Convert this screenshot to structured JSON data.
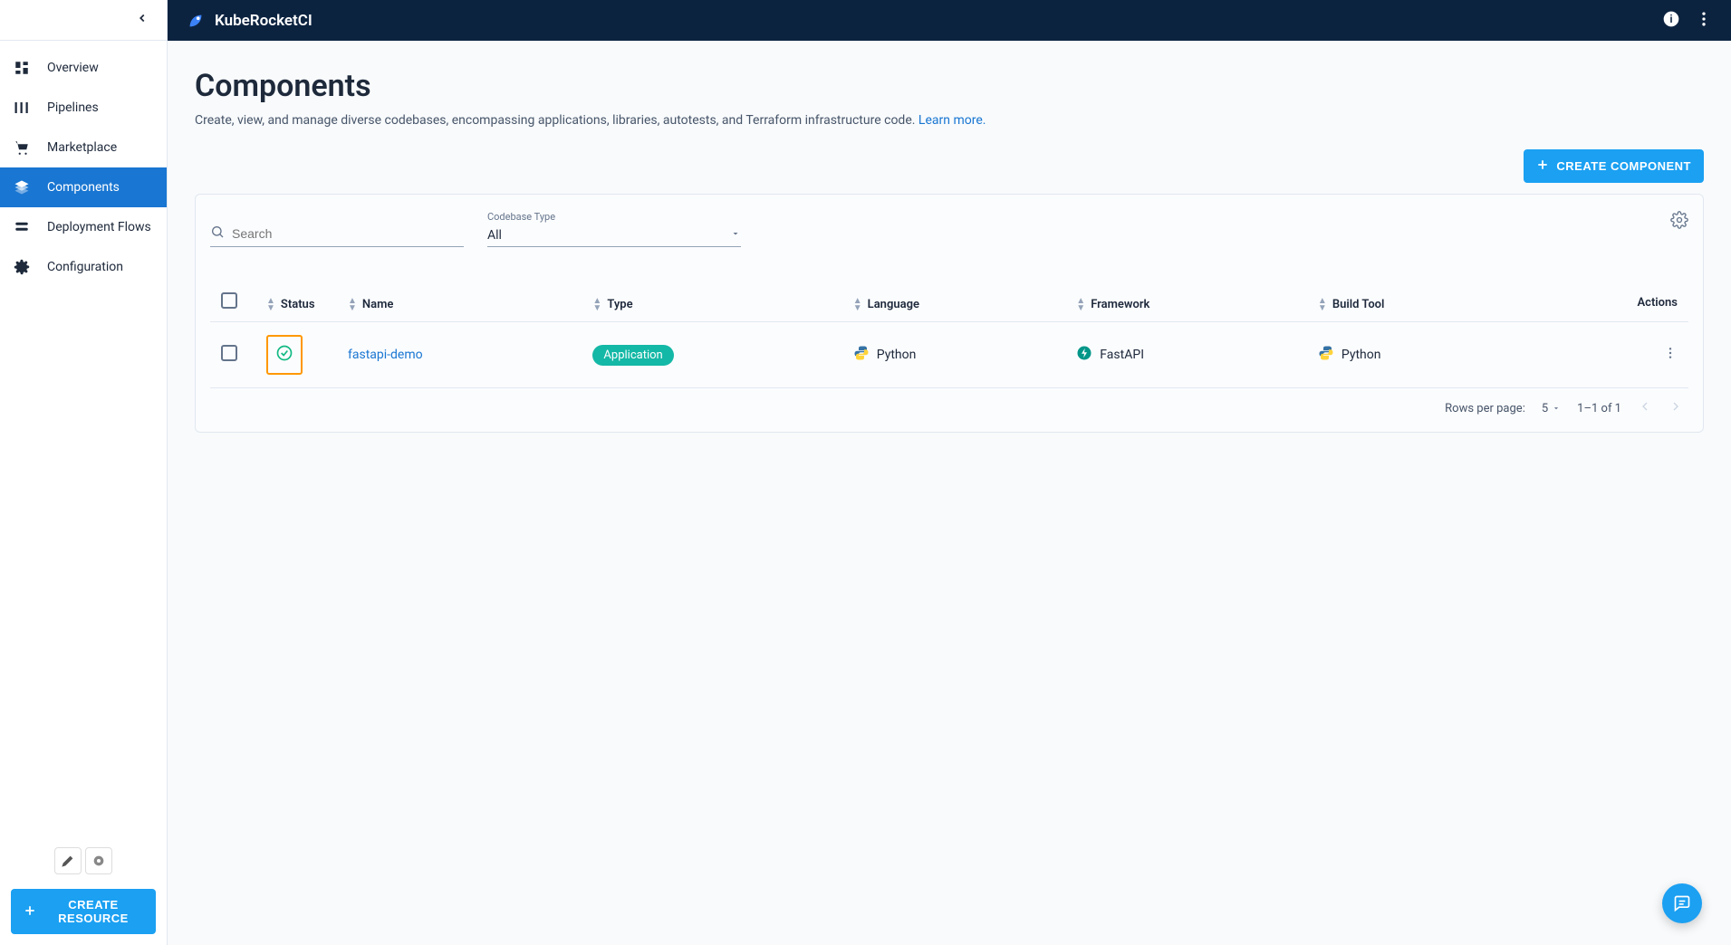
{
  "brand": {
    "name": "KubeRocketCI"
  },
  "sidebar": {
    "items": [
      {
        "label": "Overview"
      },
      {
        "label": "Pipelines"
      },
      {
        "label": "Marketplace"
      },
      {
        "label": "Components"
      },
      {
        "label": "Deployment Flows"
      },
      {
        "label": "Configuration"
      }
    ],
    "create_resource": "Create Resource"
  },
  "page": {
    "title": "Components",
    "description": "Create, view, and manage diverse codebases, encompassing applications, libraries, autotests, and Terraform infrastructure code. ",
    "learn_more": "Learn more."
  },
  "toolbar": {
    "create_component": "Create Component"
  },
  "filters": {
    "search_placeholder": "Search",
    "codebase_type_label": "Codebase Type",
    "codebase_type_value": "All"
  },
  "table": {
    "headers": {
      "status": "Status",
      "name": "Name",
      "type": "Type",
      "language": "Language",
      "framework": "Framework",
      "build_tool": "Build Tool",
      "actions": "Actions"
    },
    "rows": [
      {
        "name": "fastapi-demo",
        "type": "Application",
        "language": "Python",
        "framework": "FastAPI",
        "build_tool": "Python"
      }
    ]
  },
  "pagination": {
    "rows_per_page_label": "Rows per page:",
    "rows_per_page_value": "5",
    "range": "1–1 of 1"
  }
}
